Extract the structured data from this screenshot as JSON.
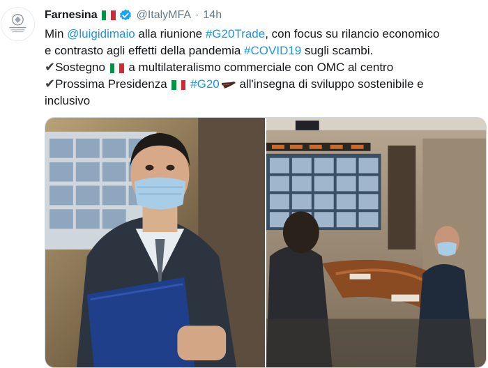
{
  "account": {
    "name": "Farnesina",
    "handle": "@ItalyMFA",
    "separator": "·",
    "time": "14h",
    "avatar_icon": "ministry-seal-icon",
    "verified_icon": "verified-badge-icon"
  },
  "tweet": {
    "line1": {
      "t1": "Min ",
      "mention": "@luigidimaio",
      "t2": " alla riunione ",
      "hashtag": "#G20Trade",
      "t3": ", con focus su rilancio economico"
    },
    "line2": {
      "t1": "e contrasto agli effetti della pandemia ",
      "hashtag": "#COVID19",
      "t2": " sugli scambi."
    },
    "line3": {
      "check": "✔",
      "t1": "Sostegno ",
      "t2": " a multilateralismo commerciale con OMC al centro"
    },
    "line4": {
      "check": "✔",
      "t1": "Prossima Presidenza ",
      "hashtag": "#G20",
      "t2": " all'insegna di sviluppo sostenibile e"
    },
    "line5": {
      "t1": "inclusivo"
    }
  },
  "colors": {
    "link": "#1b95e0",
    "muted": "#657786",
    "text": "#14171a",
    "verified": "#1da1f2"
  },
  "media": {
    "count": 2,
    "photos": [
      "photo-minister-with-mask",
      "photo-meeting-videoconference"
    ]
  }
}
